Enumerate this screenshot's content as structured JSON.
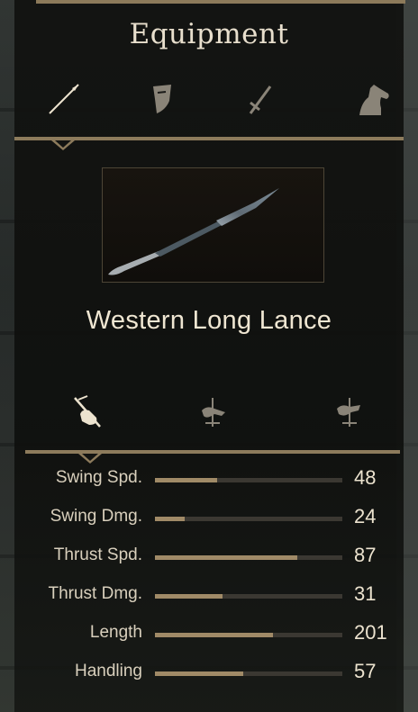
{
  "title": "Equipment",
  "equipment_tabs": [
    {
      "icon": "lance-icon",
      "selected": true
    },
    {
      "icon": "shield-icon",
      "selected": false
    },
    {
      "icon": "sword-icon",
      "selected": false
    },
    {
      "icon": "horse-icon",
      "selected": false
    }
  ],
  "item": {
    "name": "Western Long Lance"
  },
  "usage_tabs": [
    {
      "icon": "one-handed-lance-icon",
      "selected": true
    },
    {
      "icon": "couch-lance-icon",
      "selected": false
    },
    {
      "icon": "mounted-thrust-icon",
      "selected": false
    }
  ],
  "stats": [
    {
      "label": "Swing Spd.",
      "value": "48",
      "fill": 0.33
    },
    {
      "label": "Swing Dmg.",
      "value": "24",
      "fill": 0.16
    },
    {
      "label": "Thrust Spd.",
      "value": "87",
      "fill": 0.76
    },
    {
      "label": "Thrust Dmg.",
      "value": "31",
      "fill": 0.36
    },
    {
      "label": "Length",
      "value": "201",
      "fill": 0.63
    },
    {
      "label": "Handling",
      "value": "57",
      "fill": 0.47
    }
  ],
  "colors": {
    "accent": "#8d7b5c",
    "bar_fill": "#a08a67",
    "bar_track": "#3b3832",
    "text": "#efe6d2"
  }
}
